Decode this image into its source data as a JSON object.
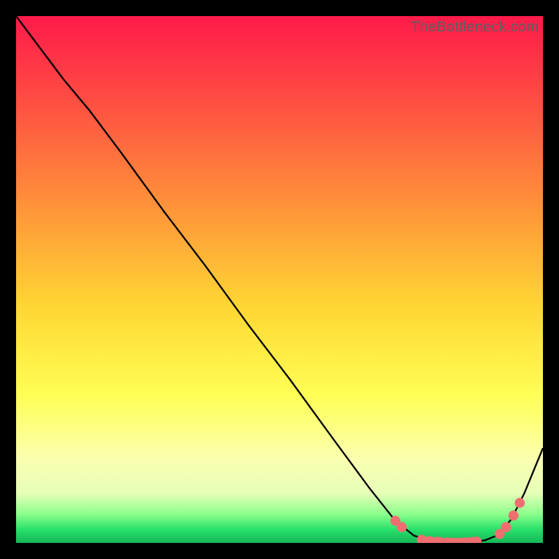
{
  "watermark": "TheBottleneck.com",
  "chart_data": {
    "type": "line",
    "title": "",
    "xlabel": "",
    "ylabel": "",
    "xlim": [
      0,
      100
    ],
    "ylim": [
      0,
      100
    ],
    "gradient_stops": [
      {
        "offset": 0,
        "color": "#ff1a4b"
      },
      {
        "offset": 0.15,
        "color": "#ff4a43"
      },
      {
        "offset": 0.35,
        "color": "#ff8f3a"
      },
      {
        "offset": 0.55,
        "color": "#ffd633"
      },
      {
        "offset": 0.72,
        "color": "#ffff55"
      },
      {
        "offset": 0.84,
        "color": "#fbffb0"
      },
      {
        "offset": 0.905,
        "color": "#e7ffb8"
      },
      {
        "offset": 0.945,
        "color": "#8cff8c"
      },
      {
        "offset": 0.975,
        "color": "#27e06a"
      },
      {
        "offset": 1.0,
        "color": "#16b657"
      }
    ],
    "series": [
      {
        "name": "bottleneck-curve",
        "color": "#000000",
        "x": [
          0,
          9,
          14,
          20,
          28,
          36,
          44,
          52,
          60,
          67,
          72,
          75.5,
          79,
          82,
          86,
          89,
          91.5,
          94,
          96.5,
          100
        ],
        "y": [
          100,
          88,
          82,
          74,
          63,
          52.5,
          41.5,
          31,
          20,
          10.5,
          4.2,
          1.4,
          0.2,
          0.0,
          0.1,
          0.5,
          1.5,
          4.5,
          9.5,
          18
        ]
      }
    ],
    "markers": {
      "name": "highlight-dots",
      "color": "#ef6f71",
      "radius": 7.2,
      "points": [
        {
          "x": 72.0,
          "y": 4.2
        },
        {
          "x": 73.2,
          "y": 3.0
        },
        {
          "x": 77.0,
          "y": 0.6
        },
        {
          "x": 78.5,
          "y": 0.35
        },
        {
          "x": 79.8,
          "y": 0.22
        },
        {
          "x": 80.6,
          "y": 0.15
        },
        {
          "x": 81.8,
          "y": 0.08
        },
        {
          "x": 82.6,
          "y": 0.05
        },
        {
          "x": 83.4,
          "y": 0.03
        },
        {
          "x": 84.4,
          "y": 0.05
        },
        {
          "x": 85.2,
          "y": 0.08
        },
        {
          "x": 86.0,
          "y": 0.12
        },
        {
          "x": 86.8,
          "y": 0.18
        },
        {
          "x": 87.4,
          "y": 0.25
        },
        {
          "x": 91.8,
          "y": 1.7
        },
        {
          "x": 93.0,
          "y": 3.0
        },
        {
          "x": 94.4,
          "y": 5.2
        },
        {
          "x": 95.6,
          "y": 7.6
        }
      ]
    }
  }
}
